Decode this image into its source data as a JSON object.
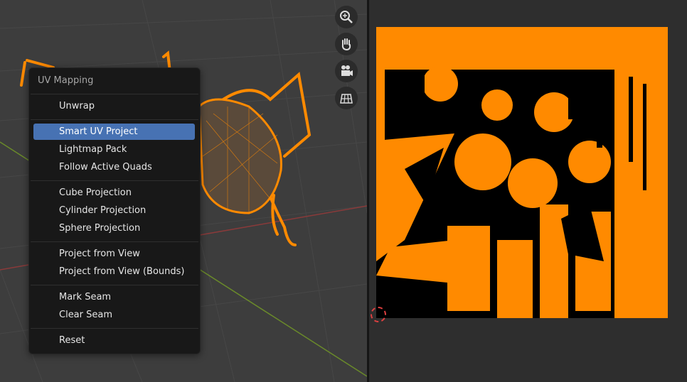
{
  "menu": {
    "title": "UV Mapping",
    "items": [
      {
        "label": "Unwrap",
        "active": false
      },
      {
        "label": "Smart UV Project",
        "active": true
      },
      {
        "label": "Lightmap Pack",
        "active": false
      },
      {
        "label": "Follow Active Quads",
        "active": false
      },
      {
        "label": "Cube Projection",
        "active": false
      },
      {
        "label": "Cylinder Projection",
        "active": false
      },
      {
        "label": "Sphere Projection",
        "active": false
      },
      {
        "label": "Project from View",
        "active": false
      },
      {
        "label": "Project from View (Bounds)",
        "active": false
      },
      {
        "label": "Mark Seam",
        "active": false
      },
      {
        "label": "Clear Seam",
        "active": false
      },
      {
        "label": "Reset",
        "active": false
      }
    ]
  },
  "navigation_gizmos": [
    "zoom-icon",
    "hand-pan-icon",
    "camera-icon",
    "grid-view-icon"
  ],
  "colors": {
    "mesh": "#ff8a00",
    "menu_bg": "#181818",
    "highlight": "#4772b3",
    "uv_bg": "#000000",
    "viewport_bg": "#3d3d3d"
  }
}
